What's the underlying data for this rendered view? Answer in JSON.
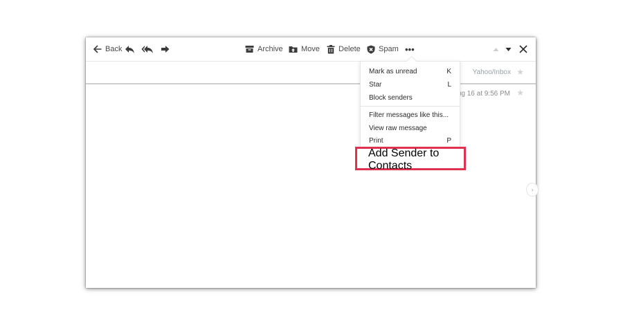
{
  "toolbar": {
    "back": "Back",
    "archive": "Archive",
    "move": "Move",
    "delete": "Delete",
    "spam": "Spam",
    "more": "•••"
  },
  "message": {
    "folder": "Yahoo/Inbox",
    "date": "Aug 16 at 9:56 PM"
  },
  "menu": {
    "items": [
      {
        "label": "Mark as unread",
        "key": "K"
      },
      {
        "label": "Star",
        "key": "L"
      },
      {
        "label": "Block senders",
        "key": ""
      },
      {
        "label": "Filter messages like this...",
        "key": ""
      },
      {
        "label": "View raw message",
        "key": ""
      },
      {
        "label": "Print",
        "key": "P"
      },
      {
        "label": "Add Sender to Contacts",
        "key": ""
      }
    ]
  },
  "colors": {
    "highlight": "#e0324f",
    "icon": "#3c3c3c"
  }
}
